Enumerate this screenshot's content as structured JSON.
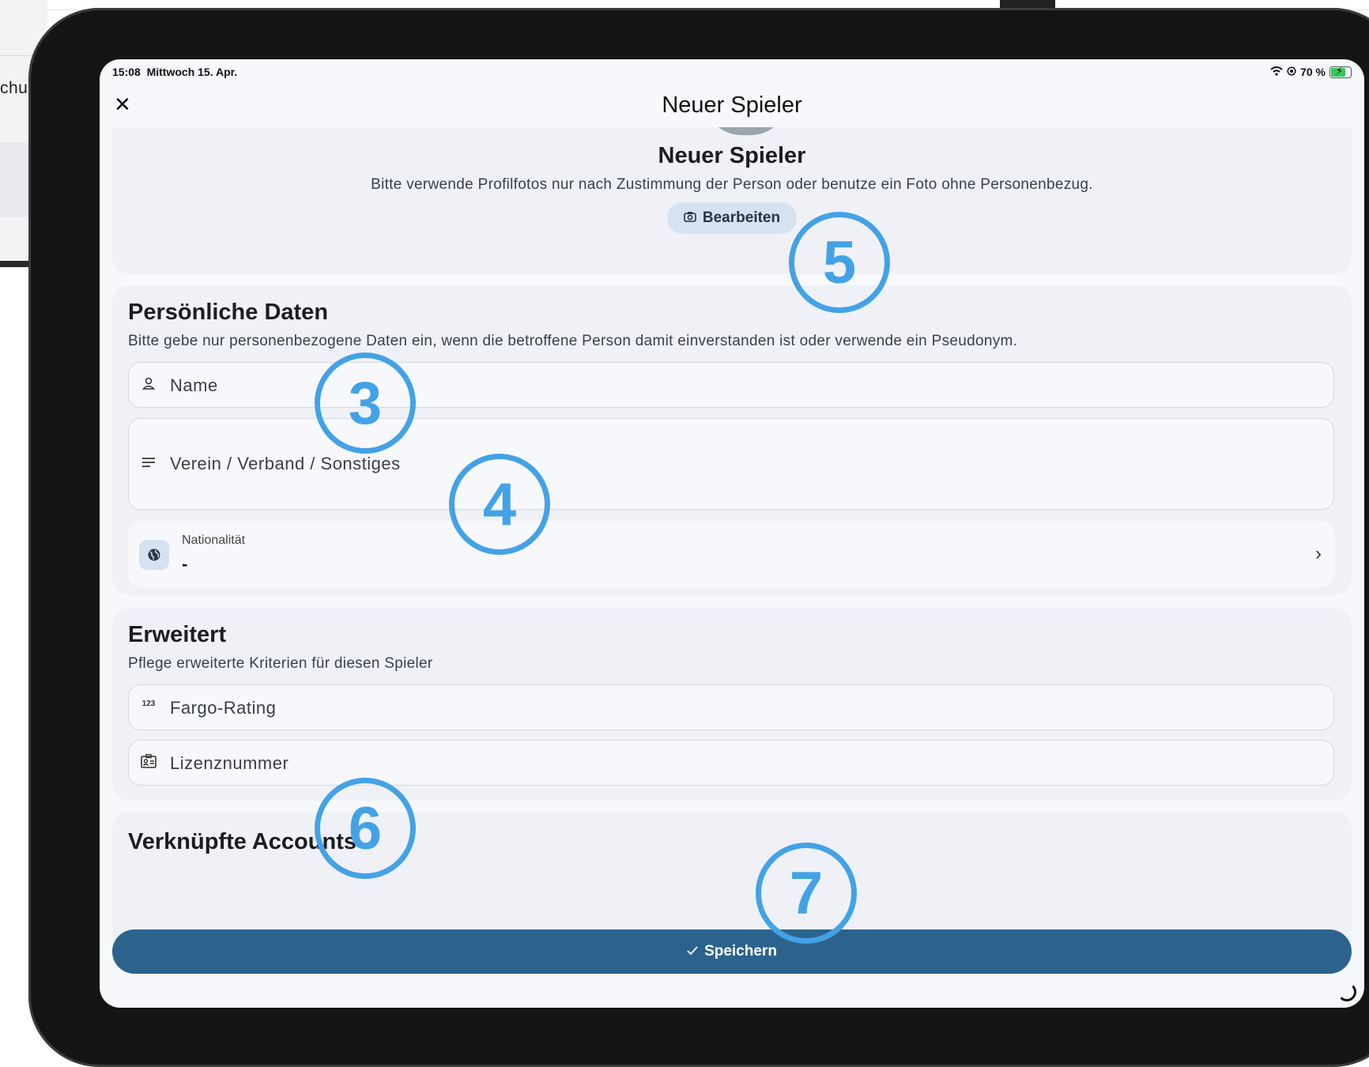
{
  "background_window": {
    "text": "chu"
  },
  "status_bar": {
    "time": "15:08",
    "date": "Mittwoch 15. Apr.",
    "battery": "70 %"
  },
  "nav": {
    "title": "Neuer Spieler"
  },
  "profile": {
    "name": "Neuer Spieler",
    "hint": "Bitte verwende Profilfotos nur nach Zustimmung der Person oder benutze ein Foto ohne Personenbezug.",
    "edit_label": "Bearbeiten"
  },
  "personal": {
    "title": "Persönliche Daten",
    "subtitle": "Bitte gebe nur personenbezogene Daten ein, wenn die betroffene Person damit einverstanden ist oder verwende ein Pseudonym.",
    "name_placeholder": "Name",
    "club_placeholder": "Verein / Verband / Sonstiges",
    "nationality_label": "Nationalität",
    "nationality_value": "-"
  },
  "extended": {
    "title": "Erweitert",
    "subtitle": "Pflege erweiterte Kriterien für diesen Spieler",
    "fargo_placeholder": "Fargo-Rating",
    "fargo_icon_text": "123",
    "license_placeholder": "Lizenznummer"
  },
  "linked": {
    "title": "Verknüpfte Accounts"
  },
  "save_label": "Speichern",
  "markers": [
    "5",
    "3",
    "4",
    "6",
    "7"
  ],
  "colors": {
    "accent": "#2c638c",
    "marker": "#43a2e6",
    "chip": "#d6e2f0"
  }
}
